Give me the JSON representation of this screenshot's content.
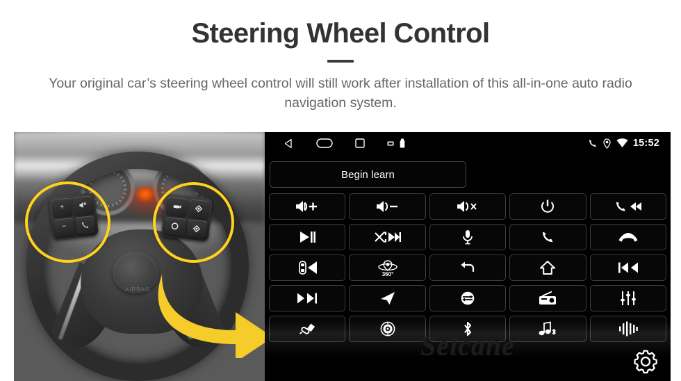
{
  "header": {
    "title": "Steering Wheel Control",
    "subtitle": "Your original car’s steering wheel control will still work after installation of this all-in-one auto radio navigation system."
  },
  "photo": {
    "alt_name": "steering-wheel-photo",
    "highlight_color": "#ffd21f",
    "arrow_color": "#f5cc2a",
    "airbag_text": "AIRBAG",
    "left_cluster": {
      "name": "left-steering-button-cluster",
      "keys": [
        {
          "name": "volume-up-key",
          "label": "+"
        },
        {
          "name": "voice-mute-key",
          "label": ""
        },
        {
          "name": "volume-down-key",
          "label": "−"
        },
        {
          "name": "phone-call-key",
          "label": ""
        }
      ]
    },
    "right_cluster": {
      "name": "right-steering-button-cluster",
      "keys": [
        {
          "name": "cruise-control-key",
          "label": ""
        },
        {
          "name": "menu-up-key",
          "label": ""
        },
        {
          "name": "mode-circle-key",
          "label": ""
        },
        {
          "name": "menu-down-key",
          "label": ""
        }
      ]
    }
  },
  "unit": {
    "statusbar": {
      "nav_icons": [
        "back-icon",
        "home-icon",
        "recents-icon"
      ],
      "tray_icons": [
        "sd-card-icon",
        "usb-icon"
      ],
      "right_icons": [
        "phone-icon",
        "location-icon",
        "wifi-icon"
      ],
      "time": "15:52"
    },
    "begin_learn_label": "Begin learn",
    "watermark": "Seicane",
    "settings_icon": "gear-icon",
    "buttons": [
      {
        "name": "volume-up-button",
        "icon": "speaker-plus",
        "row": 1,
        "col": 1
      },
      {
        "name": "volume-down-button",
        "icon": "speaker-minus",
        "row": 1,
        "col": 2
      },
      {
        "name": "mute-button",
        "icon": "speaker-x",
        "row": 1,
        "col": 3
      },
      {
        "name": "power-button",
        "icon": "power",
        "row": 1,
        "col": 4
      },
      {
        "name": "phone-previous-button",
        "icon": "phone-prev",
        "row": 1,
        "col": 5
      },
      {
        "name": "play-pause-button",
        "icon": "play-pause",
        "row": 2,
        "col": 1
      },
      {
        "name": "shuffle-next-button",
        "icon": "shuffle-next",
        "row": 2,
        "col": 2
      },
      {
        "name": "microphone-button",
        "icon": "microphone",
        "row": 2,
        "col": 3
      },
      {
        "name": "answer-call-button",
        "icon": "phone",
        "row": 2,
        "col": 4
      },
      {
        "name": "hang-up-button",
        "icon": "phone-hangup",
        "row": 2,
        "col": 5
      },
      {
        "name": "parking-sensor-button",
        "icon": "car-radar",
        "row": 3,
        "col": 1
      },
      {
        "name": "camera-360-button",
        "icon": "camera-360",
        "row": 3,
        "col": 2
      },
      {
        "name": "back-button",
        "icon": "back-arrow",
        "row": 3,
        "col": 3
      },
      {
        "name": "home-button",
        "icon": "home",
        "row": 3,
        "col": 4
      },
      {
        "name": "previous-track-button",
        "icon": "prev-track",
        "row": 3,
        "col": 5
      },
      {
        "name": "next-track-button",
        "icon": "next-track",
        "row": 4,
        "col": 1
      },
      {
        "name": "navigation-button",
        "icon": "nav-arrow",
        "row": 4,
        "col": 2
      },
      {
        "name": "source-mode-button",
        "icon": "mode-circle",
        "row": 4,
        "col": 3
      },
      {
        "name": "radio-button",
        "icon": "radio",
        "row": 4,
        "col": 4
      },
      {
        "name": "equalizer-button",
        "icon": "equalizer",
        "row": 4,
        "col": 5
      },
      {
        "name": "aux-button",
        "icon": "cable-plug",
        "row": 5,
        "col": 1
      },
      {
        "name": "dvd-button",
        "icon": "disc",
        "row": 5,
        "col": 2
      },
      {
        "name": "bluetooth-button",
        "icon": "bluetooth",
        "row": 5,
        "col": 3
      },
      {
        "name": "bluetooth-music-button",
        "icon": "bt-music",
        "row": 5,
        "col": 4
      },
      {
        "name": "voice-wave-button",
        "icon": "waveform",
        "row": 5,
        "col": 5
      }
    ],
    "camera_360_label": "360°"
  },
  "colors": {
    "page_bg": "#ffffff",
    "title": "#333333",
    "subtitle": "#666666",
    "unit_bg": "#000000",
    "button_border": "#3d3d3d",
    "highlight": "#ffd21f"
  }
}
